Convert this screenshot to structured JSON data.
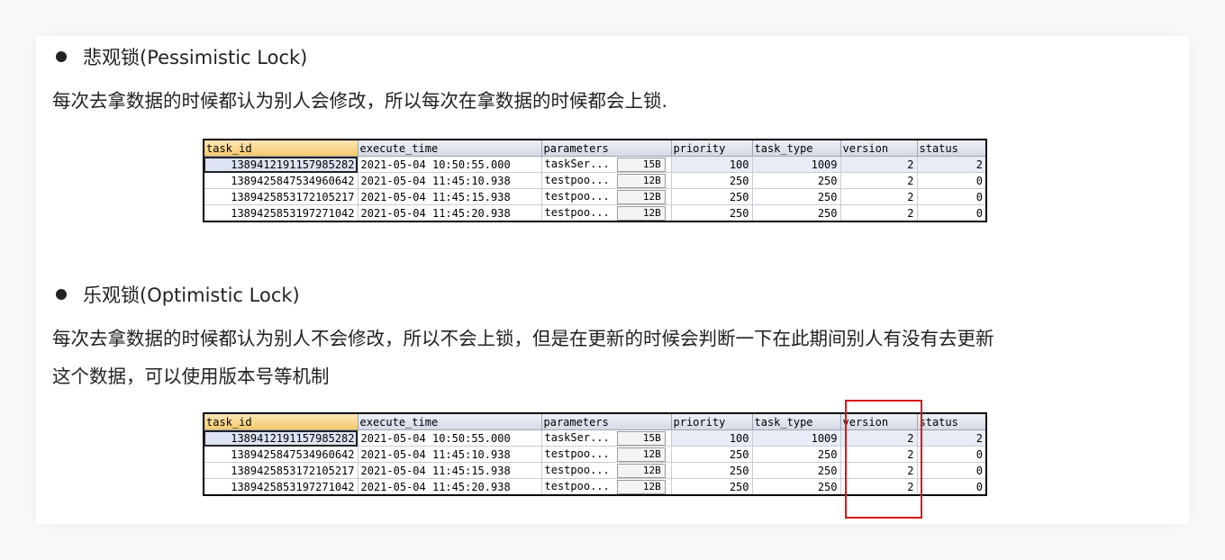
{
  "section1": {
    "heading": "悲观锁(Pessimistic Lock)",
    "text": "每次去拿数据的时候都认为别人会修改，所以每次在拿数据的时候都会上锁."
  },
  "section2": {
    "heading": "乐观锁(Optimistic Lock)",
    "text_line1": "每次去拿数据的时候都认为别人不会修改，所以不会上锁，但是在更新的时候会判断一下在此期间别人有没有去更新",
    "text_line2": "这个数据，可以使用版本号等机制"
  },
  "table": {
    "columns": [
      "task_id",
      "execute_time",
      "parameters",
      "priority",
      "task_type",
      "version",
      "status"
    ],
    "rows": [
      {
        "task_id": "1389412191157985282",
        "execute_time": "2021-05-04 10:50:55.000",
        "param_text": "taskSer...",
        "param_size": "15B",
        "priority": "100",
        "task_type": "1009",
        "version": "2",
        "status": "2"
      },
      {
        "task_id": "1389425847534960642",
        "execute_time": "2021-05-04 11:45:10.938",
        "param_text": "testpoo...",
        "param_size": "12B",
        "priority": "250",
        "task_type": "250",
        "version": "2",
        "status": "0"
      },
      {
        "task_id": "1389425853172105217",
        "execute_time": "2021-05-04 11:45:15.938",
        "param_text": "testpoo...",
        "param_size": "12B",
        "priority": "250",
        "task_type": "250",
        "version": "2",
        "status": "0"
      },
      {
        "task_id": "1389425853197271042",
        "execute_time": "2021-05-04 11:45:20.938",
        "param_text": "testpoo...",
        "param_size": "12B",
        "priority": "250",
        "task_type": "250",
        "version": "2",
        "status": "0"
      }
    ]
  },
  "highlight_color": "#d81818"
}
